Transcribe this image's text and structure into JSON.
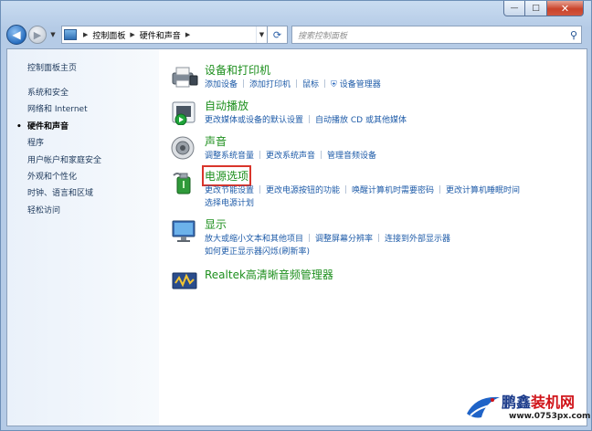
{
  "window": {
    "minimize_glyph": "—",
    "maximize_glyph": "□",
    "close_glyph": "✕"
  },
  "nav": {
    "back_glyph": "◀",
    "forward_glyph": "▶",
    "breadcrumb": [
      "控制面板",
      "硬件和声音"
    ],
    "search_placeholder": "搜索控制面板"
  },
  "sidebar": {
    "home": "控制面板主页",
    "items": [
      {
        "label": "系统和安全",
        "active": false
      },
      {
        "label": "网络和 Internet",
        "active": false
      },
      {
        "label": "硬件和声音",
        "active": true
      },
      {
        "label": "程序",
        "active": false
      },
      {
        "label": "用户帐户和家庭安全",
        "active": false
      },
      {
        "label": "外观和个性化",
        "active": false
      },
      {
        "label": "时钟、语言和区域",
        "active": false
      },
      {
        "label": "轻松访问",
        "active": false
      }
    ]
  },
  "categories": [
    {
      "title": "设备和打印机",
      "icon": "printer-icon",
      "links": [
        "添加设备",
        "添加打印机",
        "鼠标",
        "设备管理器"
      ]
    },
    {
      "title": "自动播放",
      "icon": "autoplay-icon",
      "links": [
        "更改媒体或设备的默认设置",
        "自动播放 CD 或其他媒体"
      ]
    },
    {
      "title": "声音",
      "icon": "speaker-icon",
      "links": [
        "调整系统音量",
        "更改系统声音",
        "管理音频设备"
      ]
    },
    {
      "title": "电源选项",
      "icon": "power-icon",
      "highlighted": true,
      "links": [
        "更改节能设置",
        "更改电源按钮的功能",
        "唤醒计算机时需要密码",
        "更改计算机睡眠时间",
        "选择电源计划"
      ]
    },
    {
      "title": "显示",
      "icon": "display-icon",
      "links": [
        "放大或缩小文本和其他项目",
        "调整屏幕分辨率",
        "连接到外部显示器",
        "如何更正显示器闪烁(刷新率)"
      ]
    },
    {
      "title": "Realtek高清晰音频管理器",
      "icon": "realtek-audio-icon",
      "links": []
    }
  ],
  "watermark": {
    "brand_part1": "鹏鑫",
    "brand_part2": "装机网",
    "url": "www.0753px.com"
  },
  "colors": {
    "category_title": "#1d8f1d",
    "link": "#1e5ba8",
    "highlight_box": "#d9352b"
  }
}
